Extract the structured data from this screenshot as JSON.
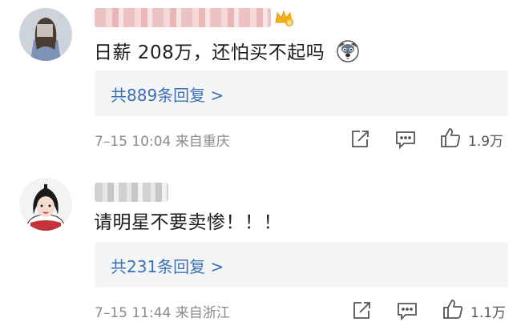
{
  "comments": [
    {
      "text": "日薪 208万，还怕买不起吗",
      "emoji": "dog-emoji",
      "replies_label": "共889条回复 >",
      "meta": "7–15 10:04  来自重庆",
      "likes": "1.9万"
    },
    {
      "text": "请明星不要卖惨！！！",
      "replies_label": "共231条回复 >",
      "meta": "7–15 11:44  来自浙江",
      "likes": "1.1万"
    }
  ],
  "colors": {
    "link": "#3b6fb6",
    "meta": "#8a8a8a",
    "reply_bg": "#f4f5f7",
    "crown": "#f2b21d"
  }
}
